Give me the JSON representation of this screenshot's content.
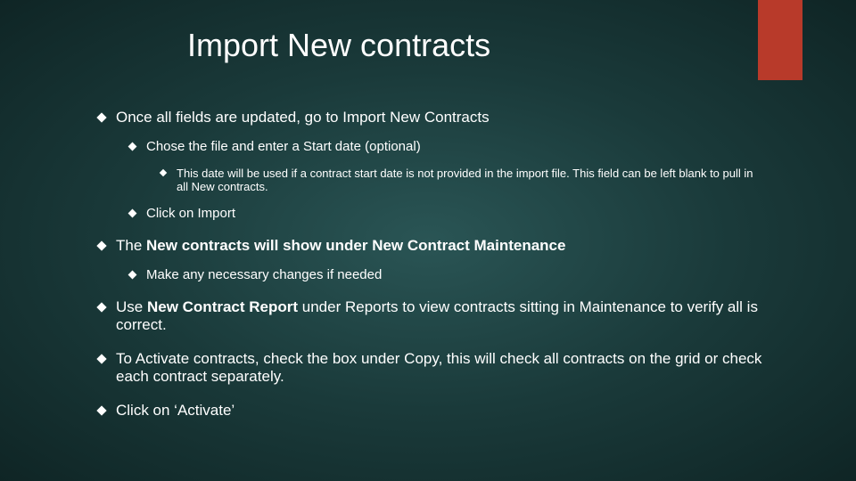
{
  "title": "Import New contracts",
  "bullets": {
    "b1": "Once all fields are updated, go to Import New Contracts",
    "b1_1": "Chose the file and enter a Start date (optional)",
    "b1_1_1": "This date will be used if a contract start date is not provided in the import file.  This field can be left blank to pull in all New contracts.",
    "b1_2": "Click on Import",
    "b2_pre": "The ",
    "b2_bold": "New contracts will show under New Contract Maintenance",
    "b2_1": "Make any necessary changes if needed",
    "b3_pre": "Use ",
    "b3_bold": "New Contract Report ",
    "b3_post": "under Reports to view contracts sitting in Maintenance to verify all is correct.",
    "b4": "To Activate contracts, check the box under Copy, this will check all contracts on the grid or check each contract separately.",
    "b5": "Click on ‘Activate’"
  }
}
